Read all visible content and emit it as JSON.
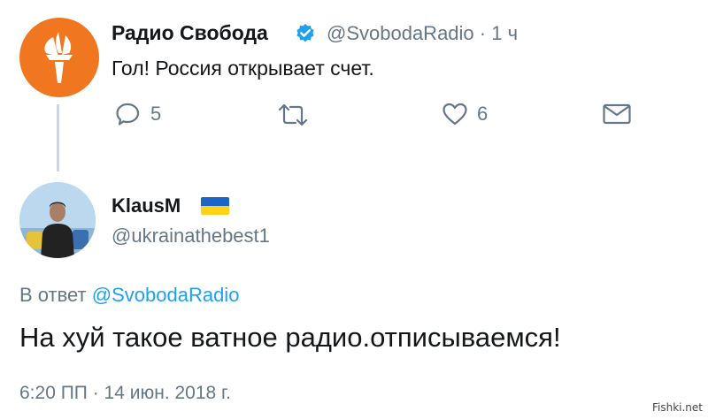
{
  "parent_tweet": {
    "display_name": "Радио Свобода",
    "handle_time": "@SvobodaRadio · 1 ч",
    "text": "Гол! Россия открывает счет.",
    "reply_count": "5",
    "like_count": "6",
    "avatar_icon": "torch-logo-icon",
    "avatar_color": "#f0771f",
    "verified_color": "#1da1f2"
  },
  "reply_tweet": {
    "display_name": "KlausM",
    "flag_icon": "ukraine-flag-icon",
    "handle": "@ukrainathebest1",
    "reply_to_prefix": "В ответ",
    "reply_to_handle": "@SvobodaRadio",
    "text": "На хуй такое ватное радио.отписываемся!",
    "timestamp": "6:20 ПП · 14 июн. 2018 г."
  },
  "colors": {
    "text": "#14171a",
    "secondary": "#657786",
    "link": "#1da1f2"
  },
  "watermark": "Fishki.net"
}
